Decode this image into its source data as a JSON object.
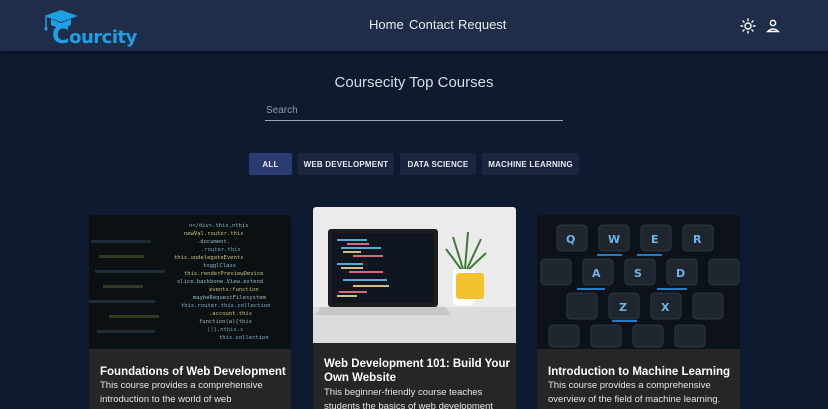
{
  "brand": {
    "logo_text_first": "C",
    "logo_text_rest": "ourcity",
    "accent_color": "#1ea0e6"
  },
  "nav": {
    "links": [
      "Home",
      "Contact",
      "Request"
    ],
    "theme_icon": "sun-icon",
    "user_icon": "user-icon"
  },
  "main": {
    "title": "Coursecity Top Courses",
    "search_placeholder": "Search",
    "filters": [
      "ALL",
      "WEB DEVELOPMENT",
      "DATA SCIENCE",
      "MACHINE LEARNING"
    ],
    "active_filter": "ALL"
  },
  "courses": [
    {
      "title": "Foundations of Web Development",
      "description_lines": [
        "This course provides a comprehensive",
        "introduction to the world of web"
      ],
      "image": "code-screen-image"
    },
    {
      "title_lines": [
        "Web Development 101: Build Your",
        "Own Website"
      ],
      "description_lines": [
        "This beginner-friendly course teaches",
        "students the basics of web development"
      ],
      "image": "laptop-desk-image"
    },
    {
      "title": "Introduction to Machine Learning",
      "description_lines": [
        "This course provides a comprehensive",
        "overview of the field of machine learning."
      ],
      "image": "keyboard-image"
    }
  ]
}
